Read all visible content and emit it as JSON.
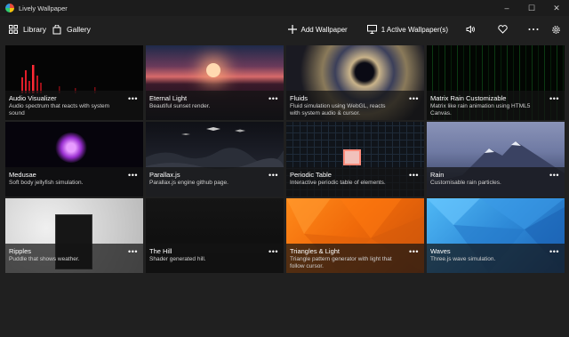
{
  "window": {
    "title": "Lively Wallpaper",
    "minimize": "–",
    "maximize": "☐",
    "close": "✕"
  },
  "nav": {
    "library": "Library",
    "gallery": "Gallery"
  },
  "toolbar": {
    "add_wallpaper": "Add Wallpaper",
    "active_wallpapers": "1 Active Wallpaper(s)"
  },
  "icons": [
    "library-icon",
    "gallery-icon",
    "plus-icon",
    "monitor-icon",
    "volume-icon",
    "heart-icon",
    "more-icon",
    "gear-icon"
  ],
  "wallpapers": [
    {
      "title": "Audio Visualizer",
      "desc": "Audio spectrum that reacts with system sound",
      "more": "•••"
    },
    {
      "title": "Eternal Light",
      "desc": "Beautiful sunset render.",
      "more": "•••",
      "selected": true
    },
    {
      "title": "Fluids",
      "desc": "Fluid simulation using WebGL, reacts with system audio & cursor.",
      "more": "•••"
    },
    {
      "title": "Matrix Rain Customizable",
      "desc": "Matrix like rain animation using HTML5 Canvas.",
      "more": "•••"
    },
    {
      "title": "Medusae",
      "desc": "Soft body jellyfish simulation.",
      "more": "•••"
    },
    {
      "title": "Parallax.js",
      "desc": "Parallax.js engine github page.",
      "more": "•••"
    },
    {
      "title": "Periodic Table",
      "desc": "Interactive periodic table of elements.",
      "more": "•••"
    },
    {
      "title": "Rain",
      "desc": "Customisable rain particles.",
      "more": "•••"
    },
    {
      "title": "Ripples",
      "desc": "Puddle that shows weather.",
      "more": "•••"
    },
    {
      "title": "The Hill",
      "desc": "Shader generated hill.",
      "more": "•••"
    },
    {
      "title": "Triangles & Light",
      "desc": "Triangle pattern generator with light that follow cursor.",
      "more": "•••"
    },
    {
      "title": "Waves",
      "desc": "Three.js wave simulation.",
      "more": "•••"
    }
  ],
  "colors": {
    "background": "#202020",
    "titlebar": "#1c1c1c",
    "selected_border": "#7aa7d8"
  }
}
